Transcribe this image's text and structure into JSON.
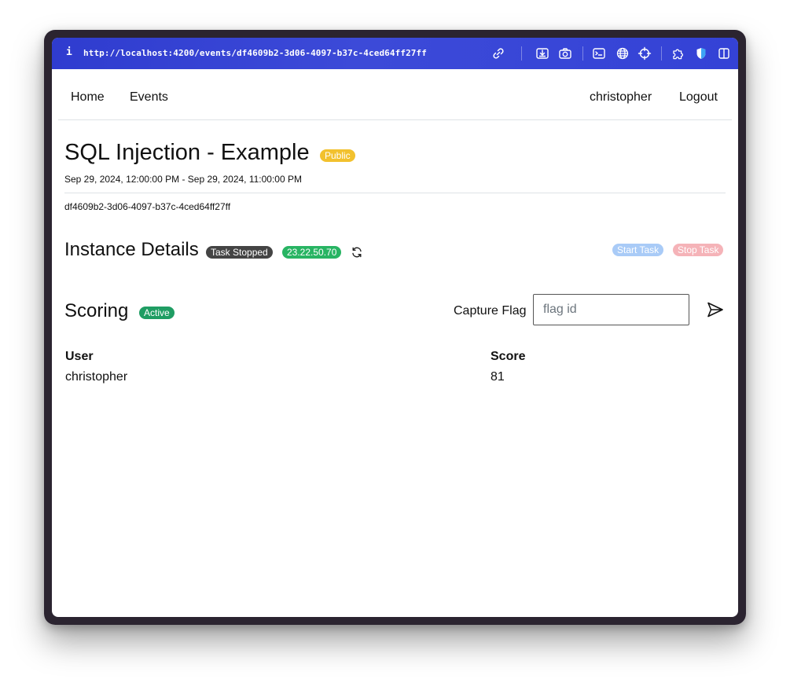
{
  "browser": {
    "info_glyph": "i",
    "url": "http://localhost:4200/events/df4609b2-3d06-4097-b37c-4ced64ff27ff",
    "toolbar_icons": [
      "link-icon",
      "download-icon",
      "camera-icon",
      "terminal-icon",
      "globe-icon",
      "crosshair-icon",
      "extension-icon",
      "shield-icon",
      "sidebar-icon"
    ]
  },
  "nav": {
    "home": "Home",
    "events": "Events",
    "user": "christopher",
    "logout": "Logout"
  },
  "event": {
    "title": "SQL Injection - Example",
    "visibility_badge": "Public",
    "dates": "Sep 29, 2024, 12:00:00 PM - Sep 29, 2024, 11:00:00 PM",
    "id": "df4609b2-3d06-4097-b37c-4ced64ff27ff"
  },
  "instance": {
    "heading": "Instance Details",
    "status_badge": "Task Stopped",
    "ip_badge": "23.22.50.70",
    "start_label": "Start Task",
    "stop_label": "Stop Task"
  },
  "scoring": {
    "heading": "Scoring",
    "status_badge": "Active",
    "capture_label": "Capture Flag",
    "flag_placeholder": "flag id",
    "columns": [
      "User",
      "Score"
    ],
    "rows": [
      {
        "user": "christopher",
        "score": "81"
      }
    ]
  },
  "colors": {
    "urlbar": "#3442d6",
    "public_badge": "#f2c12e",
    "stopped_badge": "#444444",
    "ip_badge": "#28b463",
    "active_badge": "#1f9d63",
    "start_btn": "#a9cbf7",
    "stop_btn": "#f5b3b8"
  }
}
